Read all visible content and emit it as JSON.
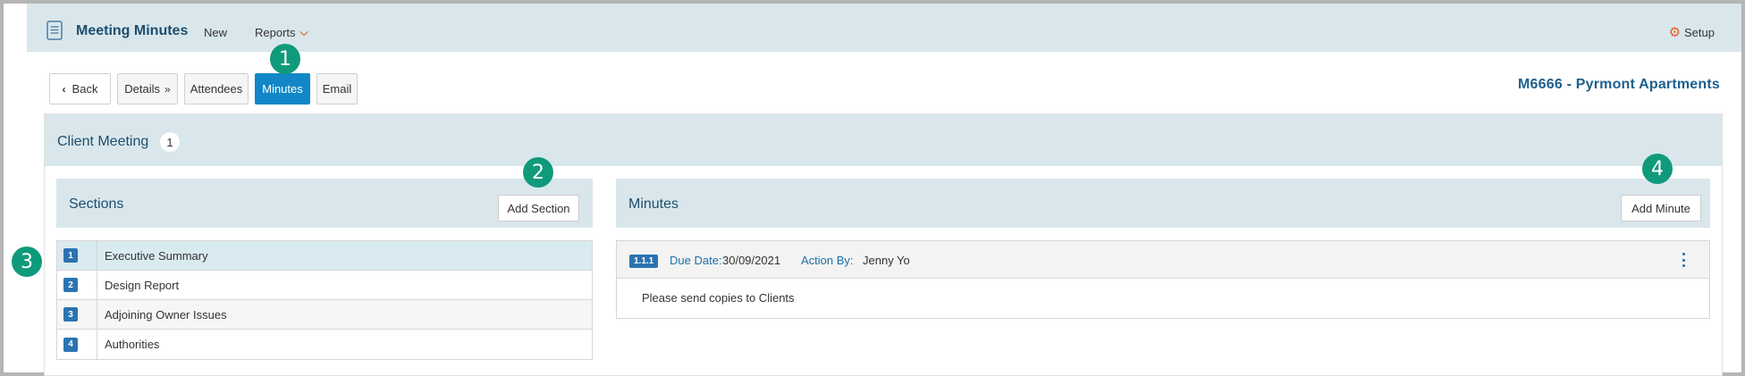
{
  "header": {
    "app_title": "Meeting Minutes",
    "nav_new": "New",
    "nav_reports": "Reports",
    "setup": "Setup",
    "icons": {
      "app": "document-icon",
      "reports_chevron": "chevron-down-icon",
      "setup": "gear-icon"
    }
  },
  "tabs": {
    "back": "Back",
    "details": "Details",
    "attendees": "Attendees",
    "minutes": "Minutes",
    "email": "Email",
    "active": "Minutes"
  },
  "project": "M6666 - Pyrmont Apartments",
  "meeting": {
    "title": "Client Meeting",
    "count": "1"
  },
  "sections": {
    "title": "Sections",
    "add_label": "Add Section",
    "items": [
      {
        "num": "1",
        "label": "Executive Summary",
        "selected": true
      },
      {
        "num": "2",
        "label": "Design Report"
      },
      {
        "num": "3",
        "label": "Adjoining Owner Issues"
      },
      {
        "num": "4",
        "label": "Authorities"
      }
    ]
  },
  "minutes": {
    "title": "Minutes",
    "add_label": "Add Minute",
    "items": [
      {
        "num": "1.1.1",
        "due_label": "Due Date:",
        "due_value": "30/09/2021",
        "action_label": "Action By:",
        "action_value": "Jenny Yo",
        "body": "Please send copies to Clients"
      }
    ]
  },
  "callouts": [
    "1",
    "2",
    "3",
    "4"
  ],
  "colors": {
    "accent": "#1187c8",
    "header_bg": "#d9e7ec",
    "callout": "#0f9a7c",
    "brand_orange": "#e45d2a"
  }
}
